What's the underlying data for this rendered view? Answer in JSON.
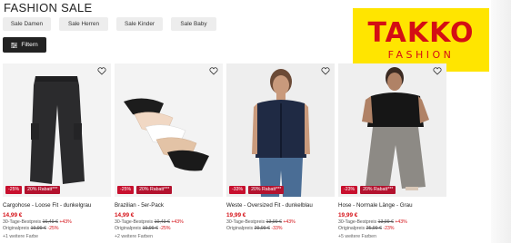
{
  "page_title": "FASHION SALE",
  "categories": [
    "Sale Damen",
    "Sale Herren",
    "Sale Kinder",
    "Sale Baby"
  ],
  "filter_label": "Filtern",
  "logo": {
    "main": "TAKKO",
    "sub": "FASHION"
  },
  "colors": {
    "brand_red": "#d40e14",
    "logo_yellow": "#ffe500",
    "badge_red": "#c8102e"
  },
  "products": [
    {
      "name": "Cargohose - Loose Fit - dunkelgrau",
      "badge_discount": "-25%",
      "badge_extra": "20% Rabatt***",
      "price": "14,99 €",
      "best_label": "30-Tage-Bestpreis",
      "best_price": "16,49 €",
      "best_pct": "+43%",
      "orig_label": "Originalpreis",
      "orig_price": "19,99 €",
      "orig_pct": "-25%",
      "more": "+1 weitere Farbe"
    },
    {
      "name": "Brazilian - 5er-Pack",
      "badge_discount": "-25%",
      "badge_extra": "20% Rabatt***",
      "price": "14,99 €",
      "best_label": "30-Tage-Bestpreis",
      "best_price": "10,49 €",
      "best_pct": "+43%",
      "orig_label": "Originalpreis",
      "orig_price": "19,99 €",
      "orig_pct": "-25%",
      "more": "+2 weitere Farben"
    },
    {
      "name": "Weste - Oversized Fit - dunkelblau",
      "badge_discount": "-33%",
      "badge_extra": "20% Rabatt***",
      "price": "19,99 €",
      "best_label": "30-Tage-Bestpreis",
      "best_price": "13,99 €",
      "best_pct": "+43%",
      "orig_label": "Originalpreis",
      "orig_price": "29,99 €",
      "orig_pct": "-33%",
      "more": ""
    },
    {
      "name": "Hose - Normale Länge - Grau",
      "badge_discount": "-23%",
      "badge_extra": "20% Rabatt***",
      "price": "19,99 €",
      "best_label": "30-Tage-Bestpreis",
      "best_price": "13,99 €",
      "best_pct": "+43%",
      "orig_label": "Originalpreis",
      "orig_price": "25,99 €",
      "orig_pct": "-23%",
      "more": "+5 weitere Farben"
    }
  ]
}
